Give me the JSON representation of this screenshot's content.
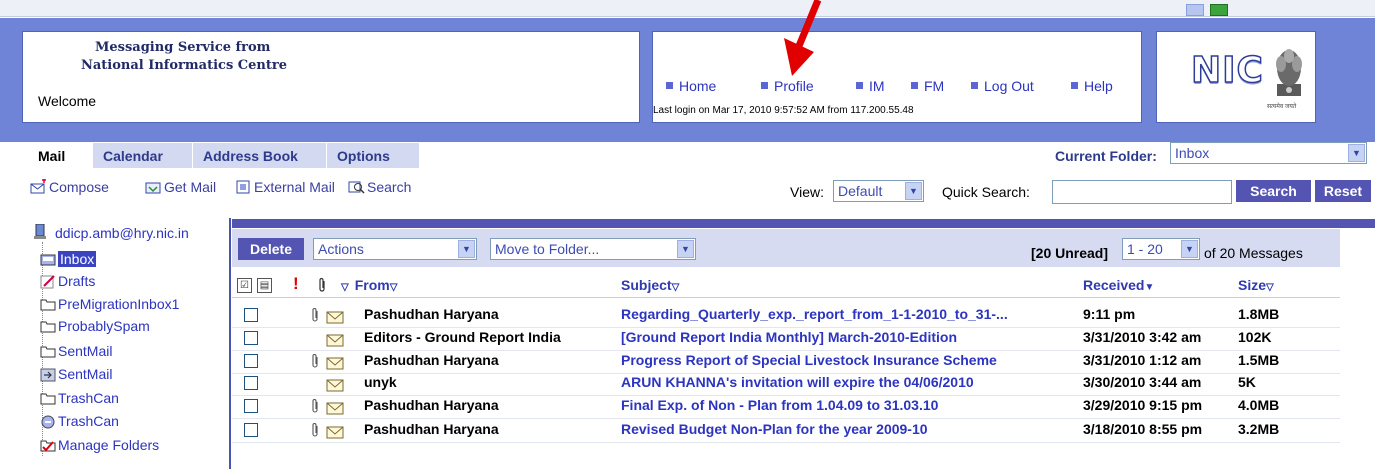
{
  "header": {
    "brand_line1": "Messaging Service from",
    "brand_line2": "National Informatics Centre",
    "welcome": "Welcome",
    "nav": [
      "Home",
      "Profile",
      "IM",
      "FM",
      "Log Out",
      "Help"
    ],
    "last_login": "Last login on Mar 17, 2010 9:57:52 AM from 117.200.55.48",
    "logo_text": "NIC",
    "emblem_caption": "सत्यमेव जयते"
  },
  "tabs": [
    "Mail",
    "Calendar",
    "Address Book",
    "Options"
  ],
  "current_folder": {
    "label": "Current Folder:",
    "value": "Inbox"
  },
  "toolbar": {
    "compose": "Compose",
    "get_mail": "Get Mail",
    "external_mail": "External Mail",
    "search": "Search",
    "view_label": "View:",
    "view_value": "Default",
    "quick_search_label": "Quick Search:",
    "quick_search_value": "",
    "search_button": "Search",
    "reset_button": "Reset"
  },
  "sidebar": {
    "account": "ddicp.amb@hry.nic.in",
    "folders": [
      "Inbox",
      "Drafts",
      "PreMigrationInbox1",
      "ProbablySpam",
      "SentMail",
      "SentMail",
      "TrashCan",
      "TrashCan",
      "Manage Folders"
    ]
  },
  "actionbar": {
    "delete": "Delete",
    "actions": "Actions",
    "move_to_folder": "Move to Folder...",
    "unread": "[20 Unread]",
    "range": "1 - 20",
    "of_messages": "of 20 Messages"
  },
  "columns": {
    "from": "From",
    "subject": "Subject",
    "received": "Received",
    "size": "Size"
  },
  "messages": [
    {
      "from": "Pashudhan Haryana",
      "subject": "Regarding_Quarterly_exp._report_from_1-1-2010_to_31-...",
      "received": "9:11 pm",
      "size": "1.8MB",
      "attachment": true
    },
    {
      "from": "Editors - Ground Report India",
      "subject": "[Ground Report India Monthly] March-2010-Edition",
      "received": "3/31/2010 3:42 am",
      "size": "102K",
      "attachment": false
    },
    {
      "from": "Pashudhan Haryana",
      "subject": "Progress Report of Special Livestock Insurance Scheme",
      "received": "3/31/2010 1:12 am",
      "size": "1.5MB",
      "attachment": true
    },
    {
      "from": "unyk",
      "subject": "ARUN KHANNA's invitation will expire the 04/06/2010",
      "received": "3/30/2010 3:44 am",
      "size": "5K",
      "attachment": false
    },
    {
      "from": "Pashudhan Haryana",
      "subject": "Final Exp. of Non - Plan from 1.04.09 to 31.03.10",
      "received": "3/29/2010 9:15 pm",
      "size": "4.0MB",
      "attachment": true
    },
    {
      "from": "Pashudhan Haryana",
      "subject": "Revised Budget Non-Plan for the year 2009-10",
      "received": "3/18/2010 8:55 pm",
      "size": "3.2MB",
      "attachment": true
    }
  ],
  "colors": {
    "frame": "#6f84d6",
    "accent": "#5454b3",
    "link": "#2c34c0",
    "arrow": "#e00000"
  }
}
